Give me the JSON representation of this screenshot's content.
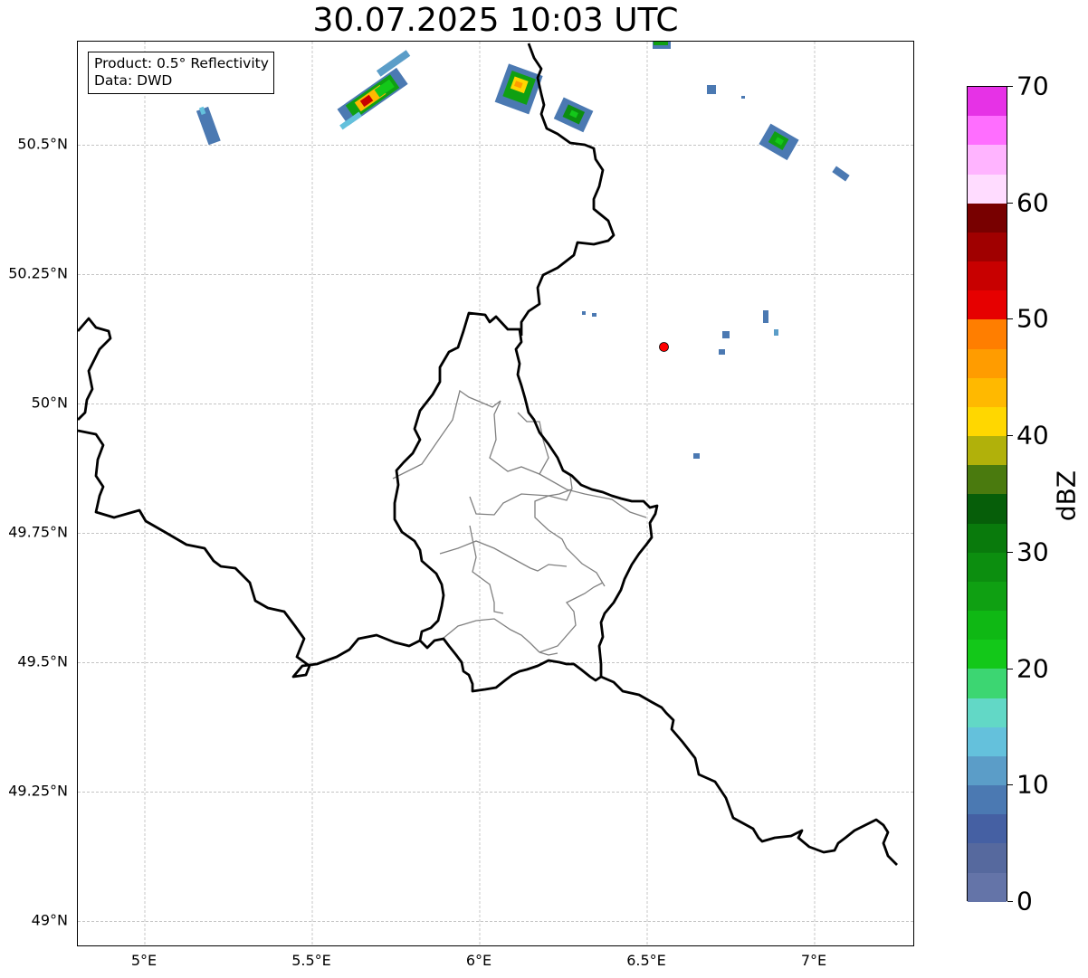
{
  "title": "30.07.2025 10:03 UTC",
  "info_box": {
    "line1": "Product: 0.5° Reflectivity",
    "line2": "Data: DWD"
  },
  "map": {
    "lon_range": [
      4.8,
      7.3
    ],
    "lat_range": [
      48.95,
      50.7
    ],
    "lon_ticks": [
      {
        "value": 5.0,
        "label": "5°E"
      },
      {
        "value": 5.5,
        "label": "5.5°E"
      },
      {
        "value": 6.0,
        "label": "6°E"
      },
      {
        "value": 6.5,
        "label": "6.5°E"
      },
      {
        "value": 7.0,
        "label": "7°E"
      }
    ],
    "lat_ticks": [
      {
        "value": 49.0,
        "label": "49°N"
      },
      {
        "value": 49.25,
        "label": "49.25°N"
      },
      {
        "value": 49.5,
        "label": "49.5°N"
      },
      {
        "value": 49.75,
        "label": "49.75°N"
      },
      {
        "value": 50.0,
        "label": "50°N"
      },
      {
        "value": 50.25,
        "label": "50.25°N"
      },
      {
        "value": 50.5,
        "label": "50.5°N"
      }
    ],
    "gridlines": true,
    "radar_site": {
      "lon": 6.55,
      "lat": 50.11,
      "color": "#ff0000"
    },
    "border_color": "#000000",
    "admin_border_color": "#808080"
  },
  "colorbar": {
    "label": "dBZ",
    "min": 0,
    "max": 70,
    "ticks": [
      {
        "value": 0,
        "label": "0"
      },
      {
        "value": 10,
        "label": "10"
      },
      {
        "value": 20,
        "label": "20"
      },
      {
        "value": 30,
        "label": "30"
      },
      {
        "value": 40,
        "label": "40"
      },
      {
        "value": 50,
        "label": "50"
      },
      {
        "value": 60,
        "label": "60"
      },
      {
        "value": 70,
        "label": "70"
      }
    ],
    "colors": [
      "#6474a8",
      "#56699e",
      "#4560a3",
      "#4b79b2",
      "#5b9dc8",
      "#64c1dc",
      "#62d8c6",
      "#3cd672",
      "#13c819",
      "#0fb814",
      "#0fa012",
      "#0c8e0f",
      "#097a0c",
      "#065e09",
      "#4a7a0e",
      "#b1b10a",
      "#ffd700",
      "#ffb900",
      "#ff9c00",
      "#ff7e00",
      "#e60000",
      "#c80000",
      "#a00000",
      "#780000",
      "#ffdcff",
      "#ffb4ff",
      "#ff6eff",
      "#e632e6"
    ]
  }
}
